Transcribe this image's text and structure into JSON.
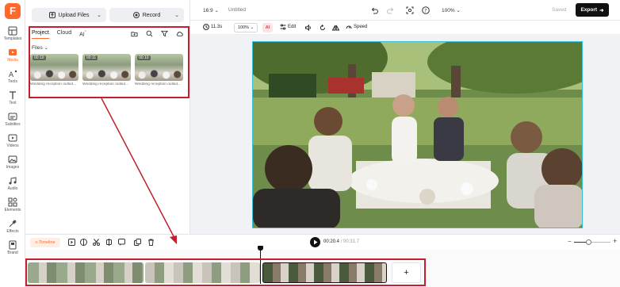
{
  "rail": {
    "logo": "F",
    "items": [
      {
        "label": "Templates",
        "icon": "templates-icon"
      },
      {
        "label": "Media",
        "icon": "media-icon"
      },
      {
        "label": "Tools",
        "icon": "tools-icon"
      },
      {
        "label": "Text",
        "icon": "text-icon"
      },
      {
        "label": "Subtitles",
        "icon": "subtitles-icon"
      },
      {
        "label": "Videos",
        "icon": "videos-icon"
      },
      {
        "label": "Images",
        "icon": "images-icon"
      },
      {
        "label": "Audio",
        "icon": "audio-icon"
      },
      {
        "label": "Elements",
        "icon": "elements-icon"
      },
      {
        "label": "Effects",
        "icon": "effects-icon"
      },
      {
        "label": "Brand",
        "icon": "brand-icon"
      }
    ],
    "active_index": 1,
    "accent": "#ff6a2c"
  },
  "panel": {
    "upload_label": "Upload Files",
    "record_label": "Record",
    "tabs": [
      {
        "label": "Project"
      },
      {
        "label": "Cloud"
      },
      {
        "label": "AI"
      }
    ],
    "ai_badge": "*",
    "files_label": "Files",
    "files": [
      {
        "duration": "00:10",
        "caption": "Wedding reception outsid..."
      },
      {
        "duration": "00:11",
        "caption": "Wedding reception outsid..."
      },
      {
        "duration": "00:10",
        "caption": "Wedding reception outsid..."
      }
    ]
  },
  "topbar": {
    "aspect": "16:9",
    "title": "Untitled",
    "zoom": "100%",
    "saved": "Saved",
    "export_label": "Export"
  },
  "editbar": {
    "duration": "11.3s",
    "scale": "100%",
    "ai_label": "AI",
    "edit_label": "Edit",
    "speed_label": "Speed"
  },
  "timeline": {
    "mode_label": "Timeline",
    "current_time": "00:20.4",
    "total_time": "/ 00:31.7",
    "add_label": "+",
    "zoom_level": 0.4
  },
  "colors": {
    "highlight": "#c21f2f",
    "preview_border": "#33c1d9",
    "accent": "#ff6a2c"
  }
}
